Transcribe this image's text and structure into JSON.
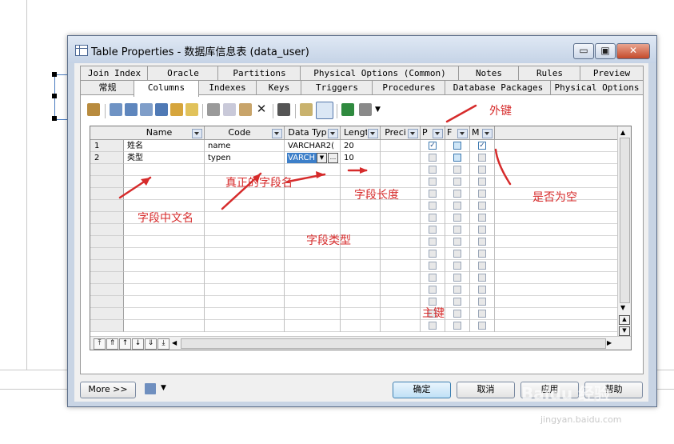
{
  "window": {
    "title": "Table Properties - 数据库信息表 (data_user)",
    "controls": {
      "minimize": "▭",
      "maximize": "▣",
      "close": "✕"
    }
  },
  "tabs": {
    "row1": [
      "Join Index",
      "Oracle",
      "Partitions",
      "Physical Options (Common)",
      "Notes",
      "Rules",
      "Preview"
    ],
    "row2": [
      "常规",
      "Columns",
      "Indexes",
      "Keys",
      "Triggers",
      "Procedures",
      "Database Packages",
      "Physical Options"
    ],
    "active": "Columns"
  },
  "grid": {
    "columns": [
      "Name",
      "Code",
      "Data Typ",
      "Lengt",
      "Preci",
      "P",
      "F",
      "M"
    ],
    "row_numbers": [
      "1",
      "2"
    ],
    "rows": [
      {
        "name": "姓名",
        "code": "name",
        "data_type": "VARCHAR2(",
        "length": "20",
        "p": true,
        "f": false,
        "m": true
      },
      {
        "name": "类型",
        "code": "typen",
        "data_type": "VARCH",
        "length": "10",
        "p": false,
        "f": false,
        "m": false
      }
    ],
    "ellipsis": "..."
  },
  "buttons": {
    "more": "More >>",
    "ok": "确定",
    "cancel": "取消",
    "apply": "应用",
    "help": "帮助"
  },
  "annotations": {
    "foreign_key": "外键",
    "real_field_name": "真正的字段名",
    "field_length": "字段长度",
    "nullable": "是否为空",
    "chinese_name": "字段中文名",
    "field_type": "字段类型",
    "primary_key": "主键"
  },
  "watermark": {
    "logo": "Baidu 经验",
    "url": "jingyan.baidu.com"
  },
  "colors": {
    "annotation": "#d62b2b",
    "checkbox_accent": "#3d79b0",
    "dialog_frame": "#c8d4e4"
  }
}
